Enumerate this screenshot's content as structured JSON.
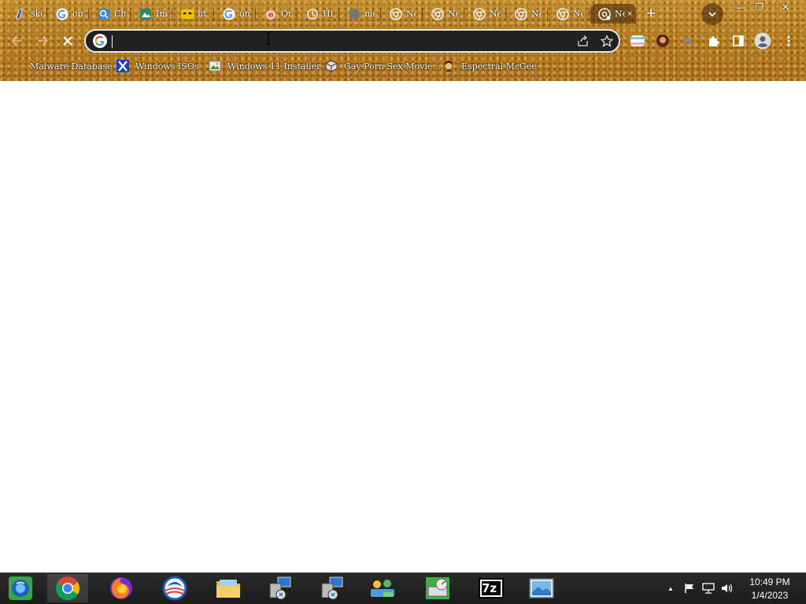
{
  "tabs": [
    {
      "title": "sketch",
      "icon": "pen-icon"
    },
    {
      "title": "om",
      "icon": "google-icon"
    },
    {
      "title": "Ch",
      "icon": "globe-search-icon"
    },
    {
      "title": "Im",
      "icon": "image-editor-icon"
    },
    {
      "title": "ht",
      "icon": "mask-icon"
    },
    {
      "title": "om",
      "icon": "google-icon"
    },
    {
      "title": "Or",
      "icon": "badge-icon"
    },
    {
      "title": "Hi",
      "icon": "history-icon"
    },
    {
      "title": "me",
      "icon": "gray-dot-icon"
    },
    {
      "title": "Ne",
      "icon": "chrome-icon"
    },
    {
      "title": "Ne",
      "icon": "chrome-icon"
    },
    {
      "title": "Ne",
      "icon": "chrome-icon"
    },
    {
      "title": "Ne",
      "icon": "chrome-icon"
    },
    {
      "title": "Ne",
      "icon": "chrome-icon"
    },
    {
      "title": "Ne",
      "icon": "chrome-loading-icon",
      "active": true,
      "close": "×"
    }
  ],
  "newtab_label": "+",
  "window_controls": {
    "minimize": "—",
    "restore": "❐",
    "close": "✕"
  },
  "omnibox": {
    "value": "",
    "placeholder": ""
  },
  "bookmarks": [
    {
      "label": "Malware Database",
      "icon": "folder-icon"
    },
    {
      "label": "Windows ISOs",
      "icon": "x-logo-icon"
    },
    {
      "label": "Windows 11 Installer",
      "icon": "image-thumb-icon"
    },
    {
      "label": "Gay Porn Sex Movie...",
      "icon": "cube-icon"
    },
    {
      "label": "Espectral McGee",
      "icon": "person-icon"
    }
  ],
  "taskbar": {
    "apps": [
      "start-orb",
      "chrome",
      "firefox",
      "outlook",
      "file-explorer",
      "installer",
      "installer",
      "network-people",
      "disk-utility",
      "7zip",
      "photo-viewer"
    ],
    "sevenzip_label": "7z"
  },
  "tray": {
    "chevron": "▲",
    "time": "10:49 PM",
    "date": "1/4/2023"
  }
}
